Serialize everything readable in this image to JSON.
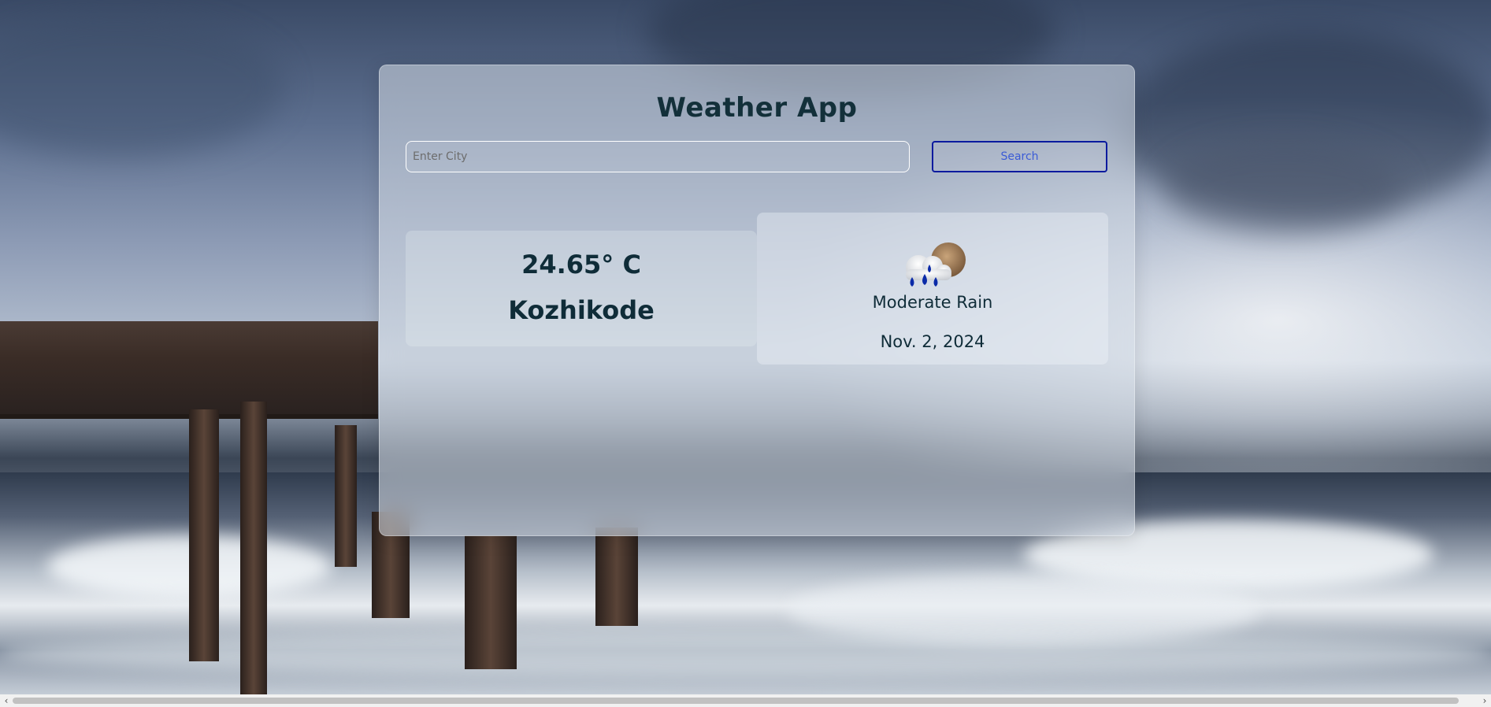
{
  "app": {
    "title": "Weather App"
  },
  "search": {
    "placeholder": "Enter City",
    "value": "",
    "button_label": "Search"
  },
  "weather": {
    "temperature": "24.65° C",
    "city": "Kozhikode",
    "condition": "Moderate Rain",
    "date": "Nov. 2, 2024",
    "icon": "moderate-rain-icon"
  },
  "scrollbar": {
    "left_arrow": "‹",
    "right_arrow": "›"
  },
  "colors": {
    "title_text": "#13303a",
    "button_border": "#0a1a9e",
    "button_text": "#3b5bd6"
  }
}
